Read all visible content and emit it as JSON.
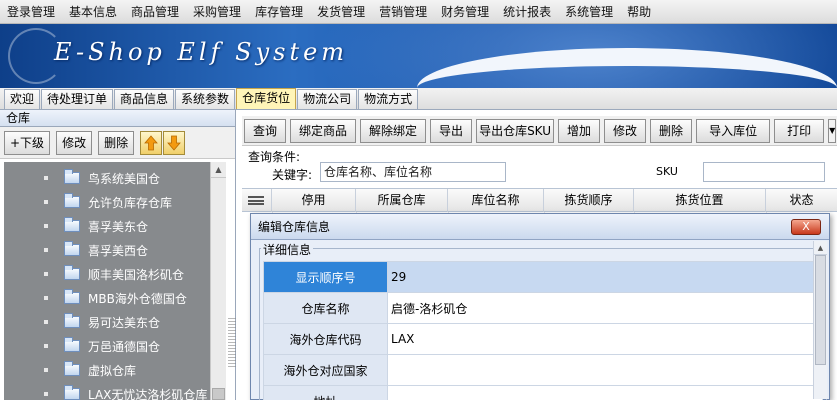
{
  "menubar": {
    "items": [
      "登录管理",
      "基本信息",
      "商品管理",
      "采购管理",
      "库存管理",
      "发货管理",
      "营销管理",
      "财务管理",
      "统计报表",
      "系统管理",
      "帮助"
    ]
  },
  "banner": {
    "logo_text": "E-Shop Elf System"
  },
  "tabs": {
    "items": [
      "欢迎",
      "待处理订单",
      "商品信息",
      "系统参数",
      "仓库货位",
      "物流公司",
      "物流方式"
    ],
    "active": "仓库货位"
  },
  "left_panel": {
    "title": "仓库",
    "toolbar": {
      "add_child": "+下级",
      "edit": "修改",
      "delete": "删除"
    },
    "tree_items": [
      "鸟系统美国仓",
      "允许负库存仓库",
      "喜孚美东仓",
      "喜孚美西仓",
      "顺丰美国洛杉矶仓",
      "MBB海外仓德国仓",
      "易可达美东仓",
      "万邑通德国仓",
      "虚拟仓库",
      "LAX无忧达洛杉矶仓库"
    ]
  },
  "right_toolbar": {
    "buttons": [
      "查询",
      "绑定商品",
      "解除绑定",
      "导出",
      "导出仓库SKU",
      "增加",
      "修改",
      "删除",
      "导入库位",
      "打印"
    ]
  },
  "query": {
    "title": "查询条件:",
    "keyword_label": "关键字:",
    "keyword_placeholder": "仓库名称、库位名称",
    "sku_label": "SKU"
  },
  "grid": {
    "columns": [
      "停用",
      "所属仓库",
      "库位名称",
      "拣货顺序",
      "拣货位置",
      "状态"
    ]
  },
  "dialog": {
    "title": "编辑仓库信息",
    "close_label": "X",
    "section_title": "详细信息",
    "fields": [
      {
        "label": "显示顺序号",
        "value": "29"
      },
      {
        "label": "仓库名称",
        "value": "启德-洛杉矶仓"
      },
      {
        "label": "海外仓库代码",
        "value": "LAX"
      },
      {
        "label": "海外仓对应国家",
        "value": ""
      },
      {
        "label": "地址",
        "value": ""
      }
    ]
  },
  "colors": {
    "banner_blue": "#1b56ab",
    "active_tab": "#fff5b8",
    "selected_label": "#2f84d8",
    "selected_value": "#c7d9f1",
    "tree_background": "#878a8d"
  }
}
